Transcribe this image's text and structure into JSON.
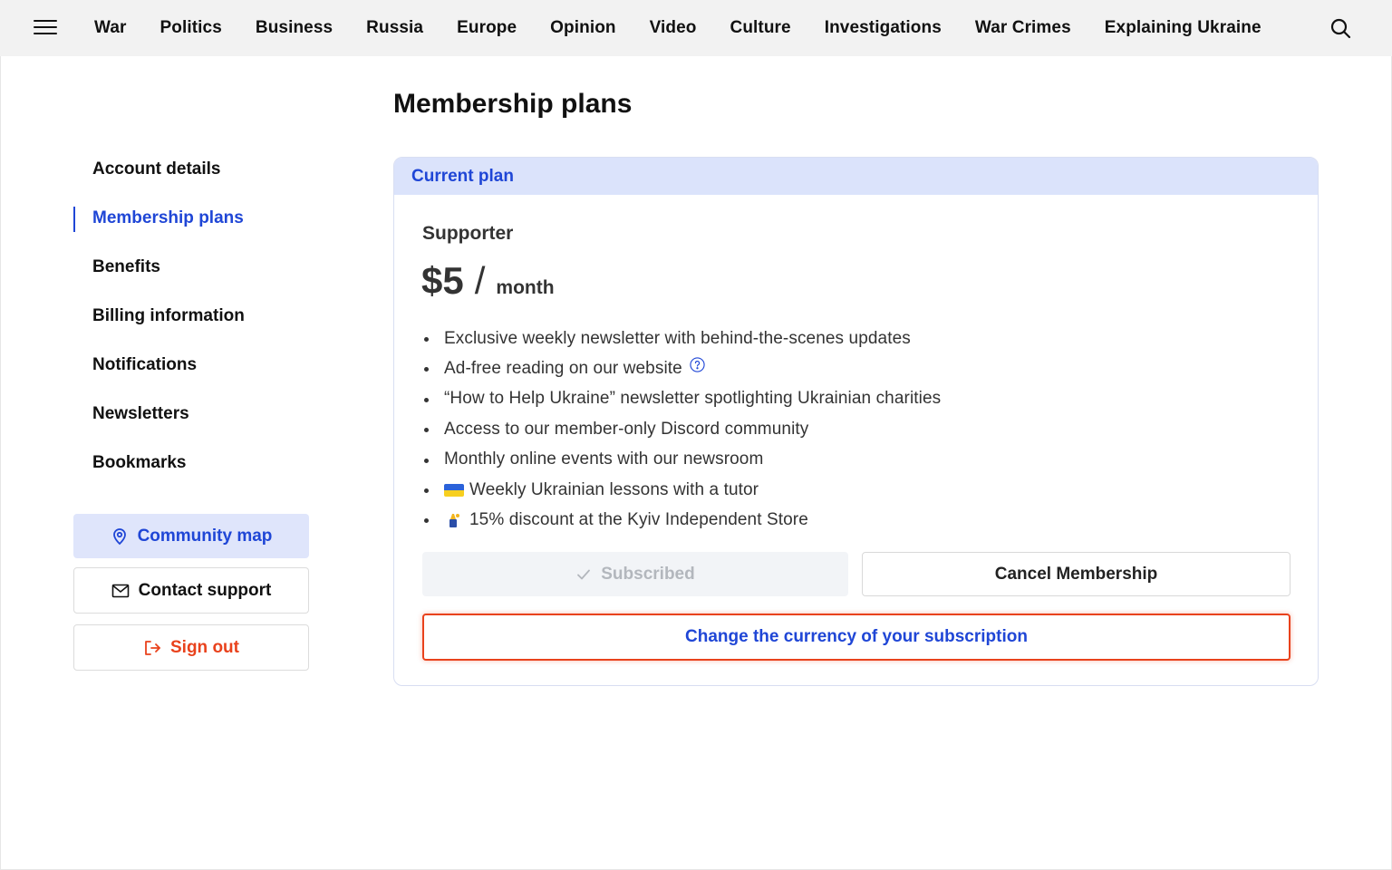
{
  "nav": {
    "links": [
      "War",
      "Politics",
      "Business",
      "Russia",
      "Europe",
      "Opinion",
      "Video",
      "Culture",
      "Investigations",
      "War Crimes",
      "Explaining Ukraine"
    ],
    "menu_icon": "hamburger-menu-icon",
    "search_icon": "search-icon"
  },
  "page": {
    "title": "Membership plans"
  },
  "sidebar": {
    "items": [
      {
        "label": "Account details",
        "active": false
      },
      {
        "label": "Membership plans",
        "active": true
      },
      {
        "label": "Benefits",
        "active": false
      },
      {
        "label": "Billing information",
        "active": false
      },
      {
        "label": "Notifications",
        "active": false
      },
      {
        "label": "Newsletters",
        "active": false
      },
      {
        "label": "Bookmarks",
        "active": false
      }
    ],
    "community_map": {
      "label": "Community map",
      "icon": "map-pin-icon"
    },
    "contact_support": {
      "label": "Contact support",
      "icon": "envelope-icon"
    },
    "sign_out": {
      "label": "Sign out",
      "icon": "sign-out-icon"
    }
  },
  "plan": {
    "header": "Current plan",
    "name": "Supporter",
    "price": "$5",
    "separator": "/",
    "period": "month",
    "benefits": [
      "Exclusive weekly newsletter with behind-the-scenes updates",
      "Ad-free reading on our website",
      "“How to Help Ukraine” newsletter spotlighting Ukrainian charities",
      "Access to our member-only Discord community",
      "Monthly online events with our newsroom",
      "Weekly Ukrainian lessons with a tutor",
      "15% discount at the Kyiv Independent Store"
    ],
    "subscribed_label": "Subscribed",
    "cancel_label": "Cancel Membership",
    "currency_label": "Change the currency of your subscription"
  },
  "colors": {
    "accent": "#1f46d6",
    "accent_bg": "#dbe3fb",
    "danger": "#e9421c",
    "nav_bg": "#f2f2f2"
  }
}
